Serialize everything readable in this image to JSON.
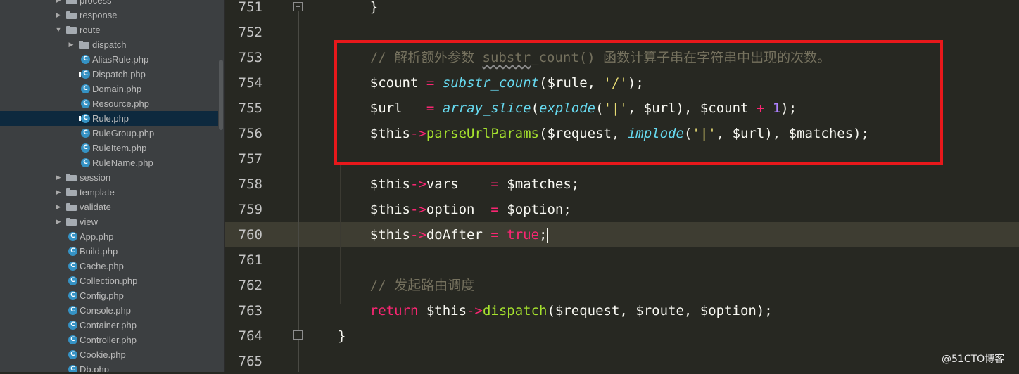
{
  "sidebar": {
    "items": [
      {
        "label": "process",
        "kind": "folder",
        "depth": 1,
        "expanded": false
      },
      {
        "label": "response",
        "kind": "folder",
        "depth": 1,
        "expanded": false
      },
      {
        "label": "route",
        "kind": "folder",
        "depth": 1,
        "expanded": true
      },
      {
        "label": "dispatch",
        "kind": "folder",
        "depth": 2,
        "expanded": false
      },
      {
        "label": "AliasRule.php",
        "kind": "file",
        "depth": 2
      },
      {
        "label": "Dispatch.php",
        "kind": "file",
        "depth": 2,
        "locked": true
      },
      {
        "label": "Domain.php",
        "kind": "file",
        "depth": 2
      },
      {
        "label": "Resource.php",
        "kind": "file",
        "depth": 2
      },
      {
        "label": "Rule.php",
        "kind": "file",
        "depth": 2,
        "locked": true,
        "selected": true
      },
      {
        "label": "RuleGroup.php",
        "kind": "file",
        "depth": 2
      },
      {
        "label": "RuleItem.php",
        "kind": "file",
        "depth": 2
      },
      {
        "label": "RuleName.php",
        "kind": "file",
        "depth": 2
      },
      {
        "label": "session",
        "kind": "folder",
        "depth": 1,
        "expanded": false
      },
      {
        "label": "template",
        "kind": "folder",
        "depth": 1,
        "expanded": false
      },
      {
        "label": "validate",
        "kind": "folder",
        "depth": 1,
        "expanded": false
      },
      {
        "label": "view",
        "kind": "folder",
        "depth": 1,
        "expanded": false
      },
      {
        "label": "App.php",
        "kind": "file",
        "depth": 1
      },
      {
        "label": "Build.php",
        "kind": "file",
        "depth": 1
      },
      {
        "label": "Cache.php",
        "kind": "file",
        "depth": 1
      },
      {
        "label": "Collection.php",
        "kind": "file",
        "depth": 1
      },
      {
        "label": "Config.php",
        "kind": "file",
        "depth": 1
      },
      {
        "label": "Console.php",
        "kind": "file",
        "depth": 1
      },
      {
        "label": "Container.php",
        "kind": "file",
        "depth": 1
      },
      {
        "label": "Controller.php",
        "kind": "file",
        "depth": 1
      },
      {
        "label": "Cookie.php",
        "kind": "file",
        "depth": 1
      },
      {
        "label": "Db.php",
        "kind": "file",
        "depth": 1
      }
    ],
    "file_badge": "C",
    "icons": {
      "folder": "folder-icon",
      "file": "php-class-icon",
      "arrow_expanded": "▼",
      "arrow_collapsed": "▶"
    }
  },
  "editor": {
    "current_line": "760",
    "lines": [
      {
        "num": "751",
        "tokens": [
          {
            "t": "    }"
          }
        ]
      },
      {
        "num": "752",
        "tokens": []
      },
      {
        "num": "753",
        "tokens": [
          {
            "t": "    "
          },
          {
            "t": "// 解析额外参数 ",
            "c": "c"
          },
          {
            "t": "substr",
            "c": "c sq"
          },
          {
            "t": "_count() 函数计算子串在字符串中出现的次数。",
            "c": "c"
          }
        ]
      },
      {
        "num": "754",
        "tokens": [
          {
            "t": "    $count "
          },
          {
            "t": "=",
            "c": "kw"
          },
          {
            "t": " "
          },
          {
            "t": "substr_count",
            "c": "fn"
          },
          {
            "t": "($rule, "
          },
          {
            "t": "'/'",
            "c": "s"
          },
          {
            "t": ");"
          }
        ]
      },
      {
        "num": "755",
        "tokens": [
          {
            "t": "    $url   "
          },
          {
            "t": "=",
            "c": "kw"
          },
          {
            "t": " "
          },
          {
            "t": "array_slice",
            "c": "fn"
          },
          {
            "t": "("
          },
          {
            "t": "explode",
            "c": "fn"
          },
          {
            "t": "("
          },
          {
            "t": "'|'",
            "c": "s"
          },
          {
            "t": ", $url), $count "
          },
          {
            "t": "+",
            "c": "kw"
          },
          {
            "t": " "
          },
          {
            "t": "1",
            "c": "n"
          },
          {
            "t": ");"
          }
        ]
      },
      {
        "num": "756",
        "tokens": [
          {
            "t": "    $this"
          },
          {
            "t": "->",
            "c": "kw"
          },
          {
            "t": "parseUrlParams",
            "c": "m"
          },
          {
            "t": "($request, "
          },
          {
            "t": "implode",
            "c": "fn"
          },
          {
            "t": "("
          },
          {
            "t": "'|'",
            "c": "s"
          },
          {
            "t": ", $url), $matches);"
          }
        ]
      },
      {
        "num": "757",
        "tokens": []
      },
      {
        "num": "758",
        "tokens": [
          {
            "t": "    $this"
          },
          {
            "t": "->",
            "c": "kw"
          },
          {
            "t": "vars    "
          },
          {
            "t": "=",
            "c": "kw"
          },
          {
            "t": " $matches;"
          }
        ]
      },
      {
        "num": "759",
        "tokens": [
          {
            "t": "    $this"
          },
          {
            "t": "->",
            "c": "kw"
          },
          {
            "t": "option  "
          },
          {
            "t": "=",
            "c": "kw"
          },
          {
            "t": " $option;"
          }
        ]
      },
      {
        "num": "760",
        "tokens": [
          {
            "t": "    $this"
          },
          {
            "t": "->",
            "c": "kw"
          },
          {
            "t": "doAfter "
          },
          {
            "t": "=",
            "c": "kw"
          },
          {
            "t": " "
          },
          {
            "t": "true",
            "c": "kw"
          },
          {
            "t": ";"
          },
          {
            "cursor": true
          }
        ]
      },
      {
        "num": "761",
        "tokens": []
      },
      {
        "num": "762",
        "tokens": [
          {
            "t": "    "
          },
          {
            "t": "// 发起路由调度",
            "c": "c"
          }
        ]
      },
      {
        "num": "763",
        "tokens": [
          {
            "t": "    "
          },
          {
            "t": "return",
            "c": "kw"
          },
          {
            "t": " $this"
          },
          {
            "t": "->",
            "c": "kw"
          },
          {
            "t": "dispatch",
            "c": "m"
          },
          {
            "t": "($request, $route, $option);"
          }
        ]
      },
      {
        "num": "764",
        "tokens": [
          {
            "t": "}"
          }
        ]
      },
      {
        "num": "765",
        "tokens": []
      }
    ]
  },
  "watermark": "@51CTO博客",
  "colors": {
    "background": "#272822",
    "sidebar": "#3c3f41",
    "selected_row": "#0d293e",
    "keyword": "#f92672",
    "function": "#66d9ef",
    "method": "#a6e22e",
    "string": "#e6db74",
    "number": "#ae81ff",
    "comment": "#75715e",
    "highlight_box": "#e8181b"
  }
}
